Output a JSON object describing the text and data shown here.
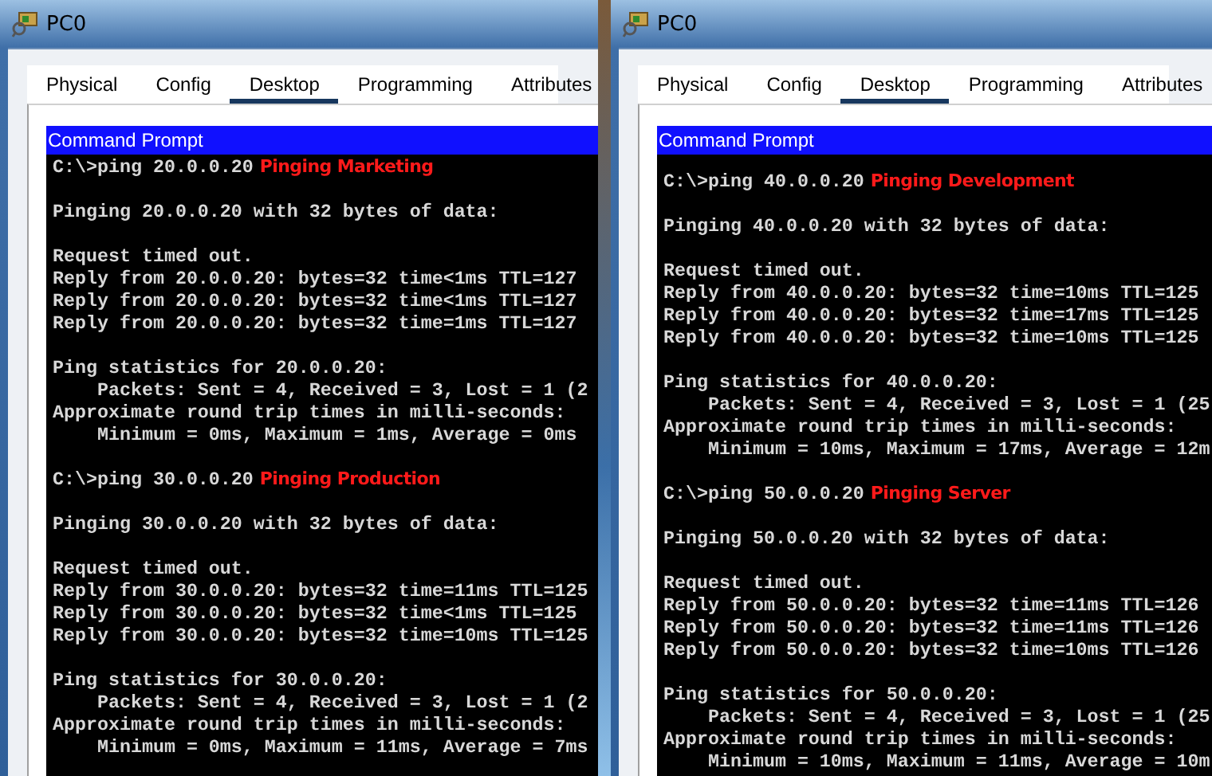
{
  "windows": [
    {
      "title": "PC0",
      "tabs": [
        {
          "label": "Physical",
          "selected": false
        },
        {
          "label": "Config",
          "selected": false
        },
        {
          "label": "Desktop",
          "selected": true
        },
        {
          "label": "Programming",
          "selected": false
        },
        {
          "label": "Attributes",
          "selected": false
        }
      ],
      "console_title": "Command Prompt",
      "pings": [
        {
          "command": "C:\\>ping 20.0.0.20",
          "note": "Pinging Marketing",
          "paragraphs": [
            [
              "Pinging 20.0.0.20 with 32 bytes of data:"
            ],
            [
              "Request timed out.",
              "Reply from 20.0.0.20: bytes=32 time<1ms TTL=127",
              "Reply from 20.0.0.20: bytes=32 time<1ms TTL=127",
              "Reply from 20.0.0.20: bytes=32 time=1ms TTL=127"
            ],
            [
              "Ping statistics for 20.0.0.20:",
              "    Packets: Sent = 4, Received = 3, Lost = 1 (2",
              "Approximate round trip times in milli-seconds:",
              "    Minimum = 0ms, Maximum = 1ms, Average = 0ms"
            ]
          ]
        },
        {
          "command": "C:\\>ping 30.0.0.20",
          "note": "Pinging Production",
          "paragraphs": [
            [
              "Pinging 30.0.0.20 with 32 bytes of data:"
            ],
            [
              "Request timed out.",
              "Reply from 30.0.0.20: bytes=32 time=11ms TTL=125",
              "Reply from 30.0.0.20: bytes=32 time<1ms TTL=125",
              "Reply from 30.0.0.20: bytes=32 time=10ms TTL=125"
            ],
            [
              "Ping statistics for 30.0.0.20:",
              "    Packets: Sent = 4, Received = 3, Lost = 1 (2",
              "Approximate round trip times in milli-seconds:",
              "    Minimum = 0ms, Maximum = 11ms, Average = 7ms"
            ]
          ]
        }
      ]
    },
    {
      "title": "PC0",
      "tabs": [
        {
          "label": "Physical",
          "selected": false
        },
        {
          "label": "Config",
          "selected": false
        },
        {
          "label": "Desktop",
          "selected": true
        },
        {
          "label": "Programming",
          "selected": false
        },
        {
          "label": "Attributes",
          "selected": false
        }
      ],
      "console_title": "Command Prompt",
      "pings": [
        {
          "command": "C:\\>ping 40.0.0.20",
          "note": "Pinging Development",
          "paragraphs": [
            [
              "Pinging 40.0.0.20 with 32 bytes of data:"
            ],
            [
              "Request timed out.",
              "Reply from 40.0.0.20: bytes=32 time=10ms TTL=125",
              "Reply from 40.0.0.20: bytes=32 time=17ms TTL=125",
              "Reply from 40.0.0.20: bytes=32 time=10ms TTL=125"
            ],
            [
              "Ping statistics for 40.0.0.20:",
              "    Packets: Sent = 4, Received = 3, Lost = 1 (25",
              "Approximate round trip times in milli-seconds:",
              "    Minimum = 10ms, Maximum = 17ms, Average = 12m"
            ]
          ]
        },
        {
          "command": "C:\\>ping 50.0.0.20",
          "note": "Pinging Server",
          "paragraphs": [
            [
              "Pinging 50.0.0.20 with 32 bytes of data:"
            ],
            [
              "Request timed out.",
              "Reply from 50.0.0.20: bytes=32 time=11ms TTL=126",
              "Reply from 50.0.0.20: bytes=32 time=11ms TTL=126",
              "Reply from 50.0.0.20: bytes=32 time=10ms TTL=126"
            ],
            [
              "Ping statistics for 50.0.0.20:",
              "    Packets: Sent = 4, Received = 3, Lost = 1 (25",
              "Approximate round trip times in milli-seconds:",
              "    Minimum = 10ms, Maximum = 11ms, Average = 10m"
            ]
          ]
        }
      ]
    }
  ]
}
